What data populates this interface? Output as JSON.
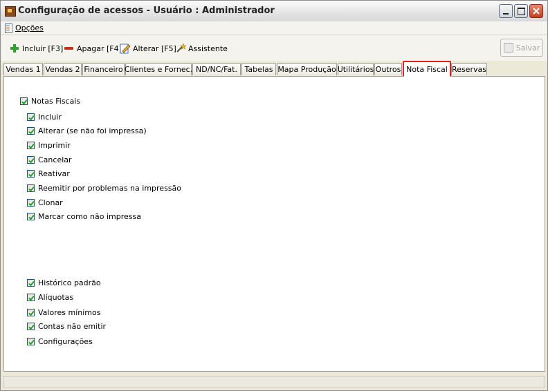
{
  "window": {
    "title": "Configuração de acessos - Usuário : Administrador"
  },
  "menu": {
    "opcoes_label": "Opções"
  },
  "toolbar": {
    "incluir_label": "Incluir [F3]",
    "apagar_label": "Apagar [F4]",
    "alterar_label": "Alterar [F5]",
    "assistente_label": "Assistente",
    "salvar_label": "Salvar"
  },
  "tabs": [
    {
      "label": "Vendas 1"
    },
    {
      "label": "Vendas 2"
    },
    {
      "label": "Financeiro"
    },
    {
      "label": "Clientes e Fornec."
    },
    {
      "label": "ND/NC/Fat."
    },
    {
      "label": "Tabelas"
    },
    {
      "label": "Mapa Produção"
    },
    {
      "label": "Utilitários"
    },
    {
      "label": "Outros"
    },
    {
      "label": "Nota Fiscal"
    },
    {
      "label": "Reservas"
    }
  ],
  "active_tab": "Nota Fiscal",
  "permissions": {
    "group_label": "Notas Fiscais",
    "group_items": [
      {
        "label": "Incluir",
        "checked": true
      },
      {
        "label": "Alterar (se não foi impressa)",
        "checked": true
      },
      {
        "label": "Imprimir",
        "checked": true
      },
      {
        "label": "Cancelar",
        "checked": true
      },
      {
        "label": "Reativar",
        "checked": true
      },
      {
        "label": "Reemitir por problemas na impressão",
        "checked": true
      },
      {
        "label": "Clonar",
        "checked": true
      },
      {
        "label": "Marcar como não impressa",
        "checked": true
      }
    ],
    "other_items": [
      {
        "label": "Histórico padrão",
        "checked": true
      },
      {
        "label": "Alíquotas",
        "checked": true
      },
      {
        "label": "Valores mínimos",
        "checked": true
      },
      {
        "label": "Contas não emitir",
        "checked": true
      },
      {
        "label": "Configurações",
        "checked": true
      }
    ]
  },
  "colors": {
    "active_tab_highlight": "#e0201a",
    "checkmark": "#21a121"
  }
}
